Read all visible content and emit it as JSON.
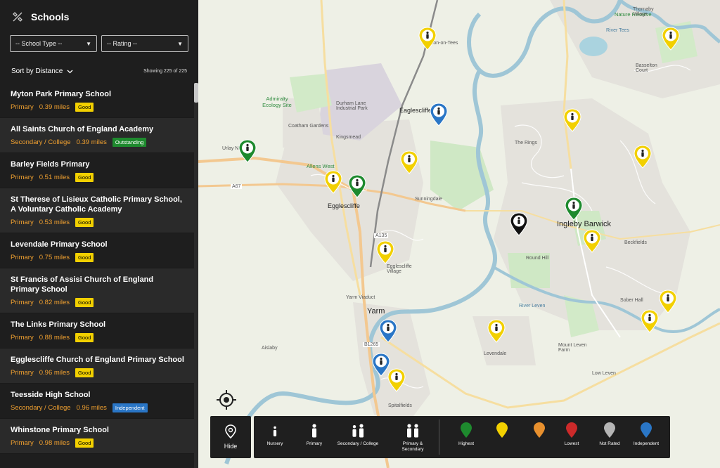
{
  "sidebar": {
    "title": "Schools",
    "icon": "tools-icon",
    "filters": {
      "school_type": "-- School Type --",
      "rating": "-- Rating --"
    },
    "sort_label": "Sort by Distance",
    "showing": "Showing 225 of 225"
  },
  "schools": [
    {
      "name": "Myton Park Primary School",
      "type": "Primary",
      "distance": "0.39 miles",
      "rating": "Good"
    },
    {
      "name": "All Saints Church of England Academy",
      "type": "Secondary / College",
      "distance": "0.39 miles",
      "rating": "Outstanding"
    },
    {
      "name": "Barley Fields Primary",
      "type": "Primary",
      "distance": "0.51 miles",
      "rating": "Good"
    },
    {
      "name": "St Therese of Lisieux Catholic Primary School, A Voluntary Catholic Academy",
      "type": "Primary",
      "distance": "0.53 miles",
      "rating": "Good"
    },
    {
      "name": "Levendale Primary School",
      "type": "Primary",
      "distance": "0.75 miles",
      "rating": "Good"
    },
    {
      "name": "St Francis of Assisi Church of England Primary School",
      "type": "Primary",
      "distance": "0.82 miles",
      "rating": "Good"
    },
    {
      "name": "The Links Primary School",
      "type": "Primary",
      "distance": "0.88 miles",
      "rating": "Good"
    },
    {
      "name": "Egglescliffe Church of England Primary School",
      "type": "Primary",
      "distance": "0.96 miles",
      "rating": "Good"
    },
    {
      "name": "Teesside High School",
      "type": "Secondary / College",
      "distance": "0.96 miles",
      "rating": "Independent"
    },
    {
      "name": "Whinstone Primary School",
      "type": "Primary",
      "distance": "0.98 miles",
      "rating": "Good"
    }
  ],
  "map": {
    "labels": {
      "preston": "Preston-on-Tees",
      "eaglescliffe": "Eaglescliffe",
      "allens_west": "Allens West",
      "egglescliffe": "Egglescliffe",
      "sunningdale": "Sunningdale",
      "kingsmead": "Kingsmead",
      "urlay_nook": "Urlay Nook",
      "coatham": "Coatham Gardens",
      "admiralty": "Admiralty Ecology Site",
      "durham_park": "Durham Lane Industrial Park",
      "ingleby": "Ingleby Barwick",
      "the_rings": "The Rings",
      "round_hill": "Round Hill",
      "beckfields": "Beckfields",
      "sober_hall": "Sober Hall",
      "yarm": "Yarm",
      "yarm_viaduct": "Yarm Viaduct",
      "aislaby": "Aislaby",
      "levendale": "Levendale",
      "mount_leven": "Mount Leven Farm",
      "low_leven": "Low Leven",
      "spitalfields": "Spitalfields",
      "river_tees": "River Tees",
      "river_leven": "River Leven",
      "a67": "A67",
      "a135": "A135",
      "b1265": "B1265",
      "nature_reserve": "Nature Reserve",
      "thornaby": "Thornaby Village",
      "basselton": "Basselton Court",
      "egglescliffe_village": "Egglescliffe Village"
    }
  },
  "legend": {
    "hide_label": "Hide",
    "types": [
      {
        "icon": "nursery-icon",
        "label": "Nursery"
      },
      {
        "icon": "primary-icon",
        "label": "Primary"
      },
      {
        "icon": "secondary-college-icon",
        "label": "Secondary / College"
      },
      {
        "icon": "primary-secondary-icon",
        "label": "Primary & Secondary"
      }
    ],
    "ratings": [
      {
        "label": "Highest",
        "color": "#1e8a2e"
      },
      {
        "label": "",
        "color": "#f2d000"
      },
      {
        "label": "",
        "color": "#e8902e"
      },
      {
        "label": "Lowest",
        "color": "#cc2a2a"
      },
      {
        "label": "Not Rated",
        "color": "#b5b5b5"
      },
      {
        "label": "Independent",
        "color": "#2a76c6"
      }
    ]
  },
  "colors": {
    "good": "#f2d000",
    "outstanding": "#1e8a2e",
    "independent": "#2a76c6",
    "selected": "#111111",
    "accent_text": "#f0a030"
  }
}
